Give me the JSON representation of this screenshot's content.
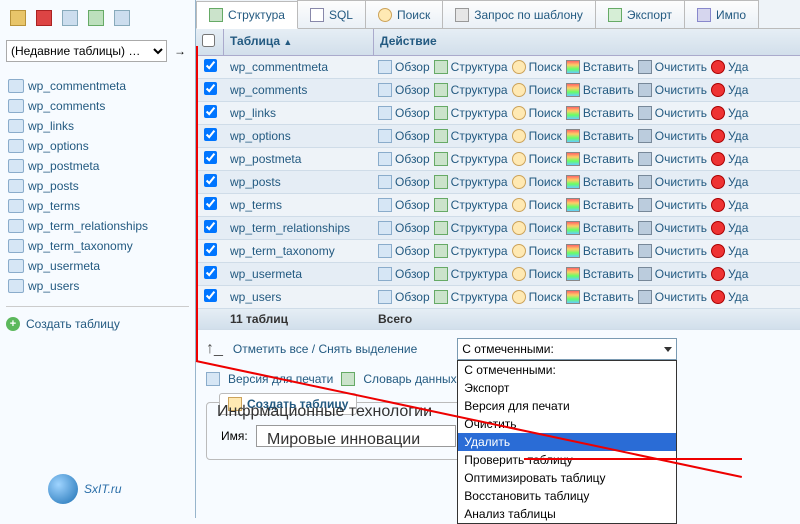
{
  "sidebar": {
    "recent_placeholder": "(Недавние таблицы) …",
    "tables": [
      "wp_commentmeta",
      "wp_comments",
      "wp_links",
      "wp_options",
      "wp_postmeta",
      "wp_posts",
      "wp_terms",
      "wp_term_relationships",
      "wp_term_taxonomy",
      "wp_usermeta",
      "wp_users"
    ],
    "create": "Создать таблицу",
    "logo": "SxIT.ru"
  },
  "tabs": {
    "structure": "Структура",
    "sql": "SQL",
    "search": "Поиск",
    "query": "Запрос по шаблону",
    "export": "Экспорт",
    "import": "Импо"
  },
  "grid": {
    "col_table": "Таблица",
    "sort_glyph": "▲",
    "col_action": "Действие",
    "rows": [
      "wp_commentmeta",
      "wp_comments",
      "wp_links",
      "wp_options",
      "wp_postmeta",
      "wp_posts",
      "wp_terms",
      "wp_term_relationships",
      "wp_term_taxonomy",
      "wp_usermeta",
      "wp_users"
    ],
    "actions": {
      "browse": "Обзор",
      "structure": "Структура",
      "search": "Поиск",
      "insert": "Вставить",
      "empty": "Очистить",
      "drop": "Уда"
    },
    "total_label": "11 таблиц",
    "total_action": "Всего"
  },
  "below": {
    "check_uncheck": "Отметить все / Снять выделение",
    "with_selected": "С отмеченными:",
    "dd": [
      "С отмеченными:",
      "Экспорт",
      "Версия для печати",
      "Очистить",
      "Удалить",
      "Проверить таблицу",
      "Оптимизировать таблицу",
      "Восстановить таблицу",
      "Анализ таблицы"
    ],
    "dd_highlight": 4,
    "print": "Версия для печати",
    "dict": "Словарь данных",
    "create_legend": "Создать таблицу",
    "name_label": "Имя:",
    "overlay1": "Инфрмационные технологии",
    "overlay2": "Мировые инновации"
  }
}
